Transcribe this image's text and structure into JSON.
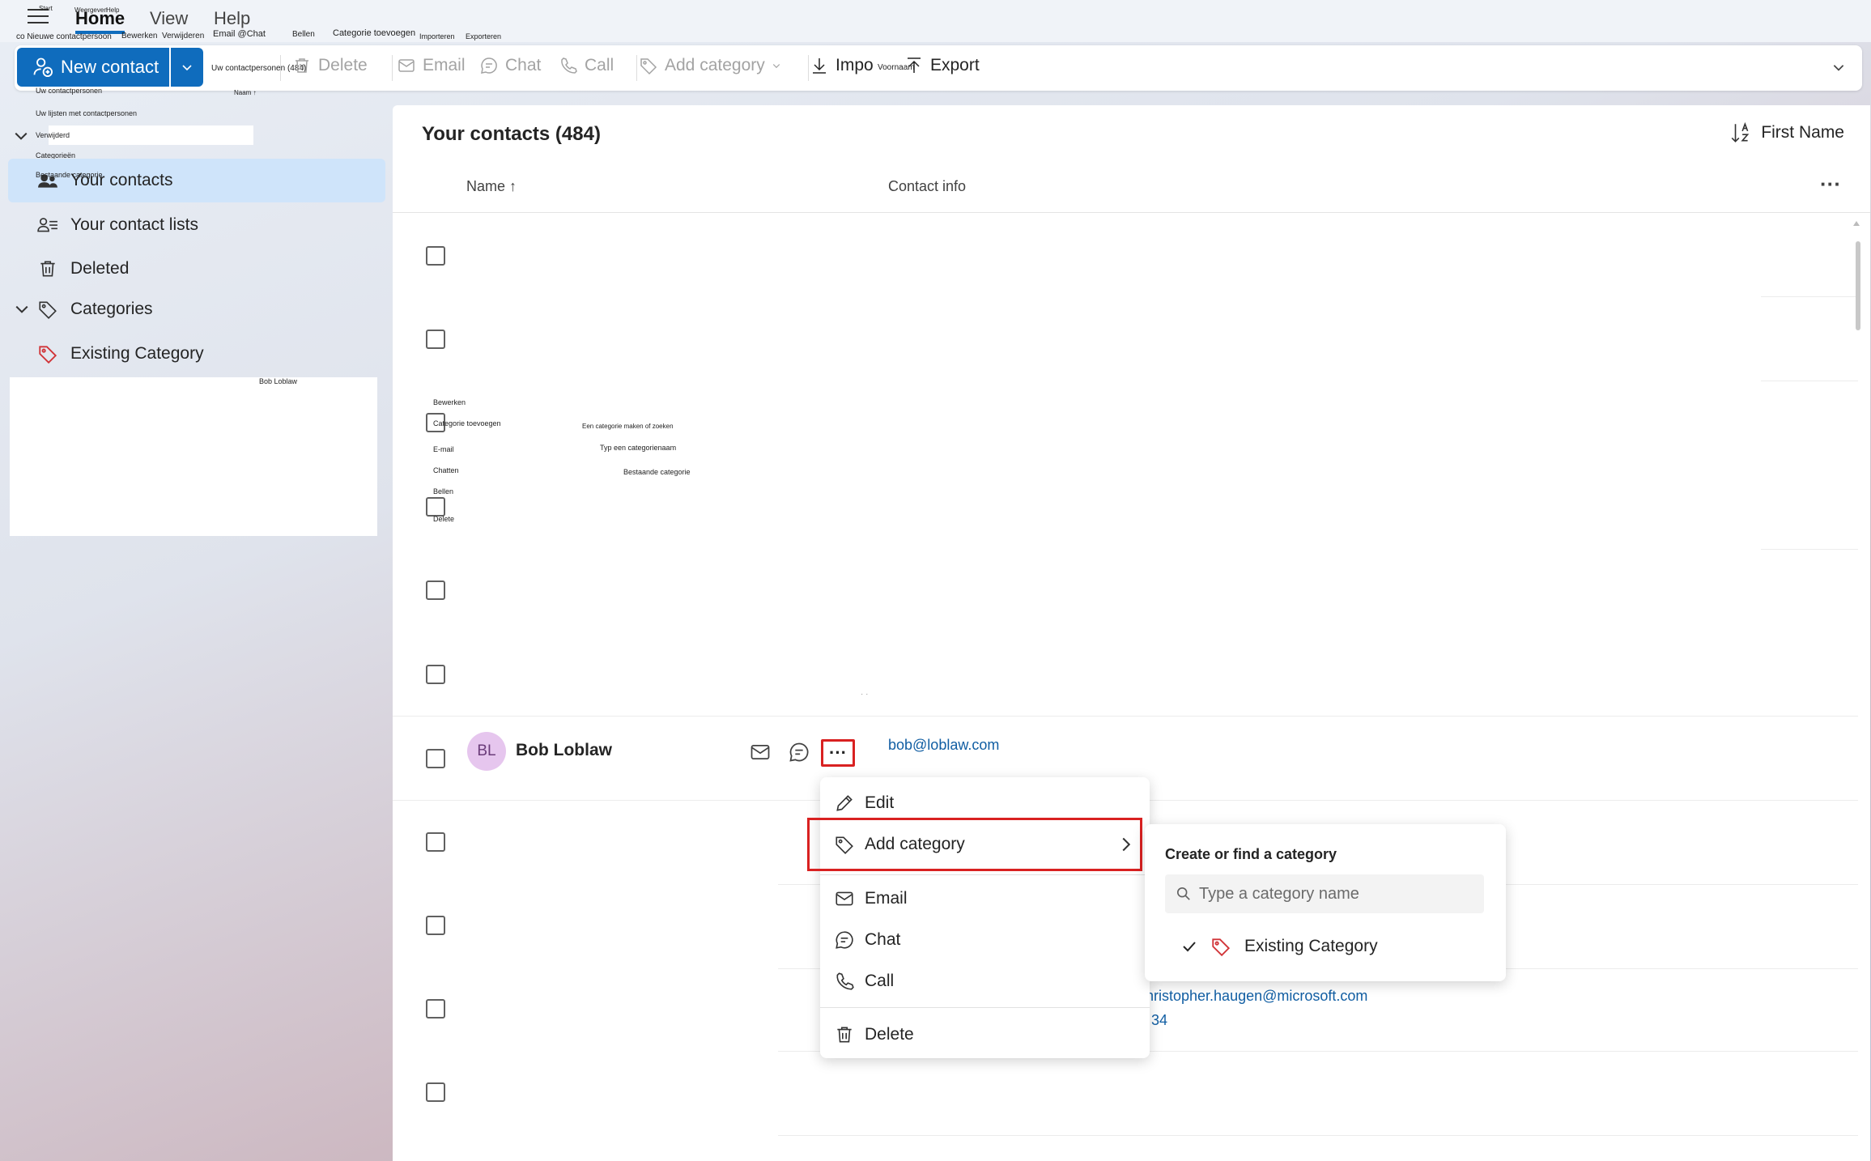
{
  "menu": {
    "tabs": [
      "Home",
      "View",
      "Help"
    ],
    "tiny_labels": {
      "start": "Start",
      "weergeven": "Weergeven",
      "help": "Help",
      "new_contact_nl": "co Nieuwe contactpersoon",
      "bewerken": "Bewerken",
      "verwijderen": "Verwijderen",
      "email_chat": "Email @Chat",
      "bellen": "Bellen",
      "categorie_toevoegen": "Categorie toevoegen",
      "importeren": "Importeren",
      "exporteren": "Exporteren"
    }
  },
  "ribbon": {
    "new_contact": "New contact",
    "edit_overlay": "Uw contactpersonen (484)",
    "delete": "Delete",
    "email": "Email",
    "chat": "Chat",
    "call": "Call",
    "add_category": "Add category",
    "import": "Impo",
    "voornaam": "Voornaam",
    "export": "Export"
  },
  "sidebar": {
    "tiny": {
      "uw_contactpersonen": "Uw contactpersonen",
      "uw_lijsten": "Uw lijsten met contactpersonen",
      "verwijderd": "Verwijderd",
      "categorieen": "Categorieën",
      "bestaande": "Bestaande categorie",
      "naam": "Naam ↑",
      "bob": "Bob Loblaw"
    },
    "items": [
      {
        "label": "Your contacts",
        "icon": "people-icon",
        "selected": true
      },
      {
        "label": "Your contact lists",
        "icon": "people-list-icon"
      },
      {
        "label": "Deleted",
        "icon": "trash-icon"
      },
      {
        "label": "Categories",
        "icon": "tag-icon"
      },
      {
        "label": "Existing Category",
        "icon": "tag-red-icon"
      }
    ]
  },
  "main": {
    "title": "Your contacts (484)",
    "sort_label": "First Name",
    "col_name": "Name ↑",
    "col_contact": "Contact info",
    "overlay_tiny": {
      "bewerken": "Bewerken",
      "categorie_toevoegen": "Categorie toevoegen",
      "email": "E-mail",
      "chatten": "Chatten",
      "bellen": "Bellen",
      "delete": "Delete",
      "maken": "Een categorie maken of zoeken",
      "typ": "Typ een categorienaam",
      "bestaande": "Bestaande categorie"
    },
    "bob": {
      "initials": "BL",
      "name": "Bob Loblaw",
      "email": "bob@loblaw.com"
    },
    "partial_email": "hristopher.haugen@microsoft.com",
    "partial_phone": "34"
  },
  "context_menu": {
    "edit": "Edit",
    "add_category": "Add category",
    "email": "Email",
    "chat": "Chat",
    "call": "Call",
    "delete": "Delete"
  },
  "submenu": {
    "title": "Create or find a category",
    "placeholder": "Type a category name",
    "existing": "Existing Category"
  },
  "colors": {
    "accent": "#0f6cbd",
    "highlight": "#d92121",
    "tag_red": "#d13438"
  }
}
